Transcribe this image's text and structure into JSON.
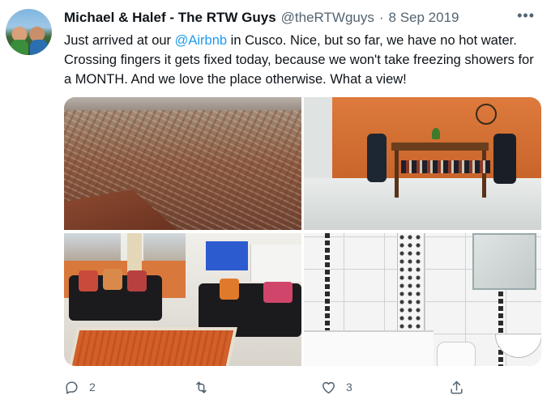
{
  "tweet": {
    "name": "Michael & Halef - The RTW Guys",
    "handle": "@theRTWguys",
    "separator": "·",
    "date": "8 Sep 2019",
    "text_before": "Just arrived at our ",
    "mention": "@Airbnb",
    "text_after": " in Cusco. Nice, but so far, we have no hot water. Crossing fingers it gets fixed today, because we won't take freezing showers for a MONTH. And we love the place otherwise. What a view!",
    "more_icon": "ellipsis-icon"
  },
  "actions": {
    "reply_count": "2",
    "retweet_count": "",
    "like_count": "3",
    "share_count": ""
  },
  "colors": {
    "text": "#0f1419",
    "muted": "#536471",
    "link": "#1d9bf0"
  }
}
